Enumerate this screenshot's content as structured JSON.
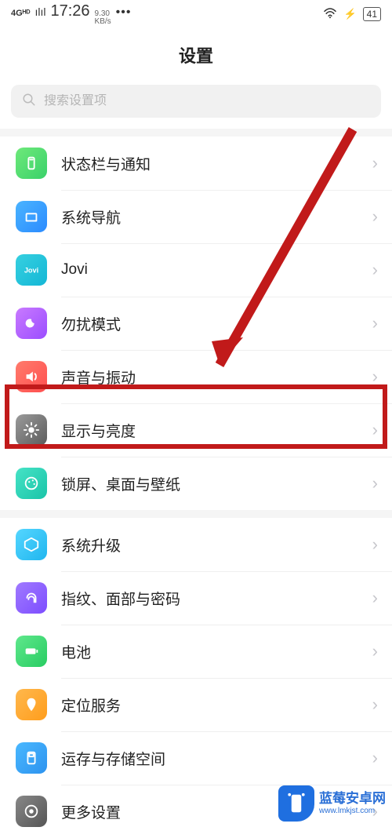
{
  "status": {
    "net": "4Gᴴᴰ",
    "signal": "ılıl",
    "time": "17:26",
    "speed_top": "9.30",
    "speed_bot": "KB/s",
    "dots": "•••",
    "battery": "41"
  },
  "header": {
    "title": "设置"
  },
  "search": {
    "placeholder": "搜索设置项"
  },
  "items": {
    "notify": "状态栏与通知",
    "nav": "系统导航",
    "jovi": "Jovi",
    "dnd": "勿扰模式",
    "sound": "声音与振动",
    "display": "显示与亮度",
    "wall": "锁屏、桌面与壁纸",
    "upgrade": "系统升级",
    "bio": "指纹、面部与密码",
    "batt": "电池",
    "loc": "定位服务",
    "storage": "运存与存储空间",
    "more": "更多设置"
  },
  "chevron": "›",
  "watermark": {
    "title": "蓝莓安卓网",
    "url": "www.lmkjst.com"
  }
}
